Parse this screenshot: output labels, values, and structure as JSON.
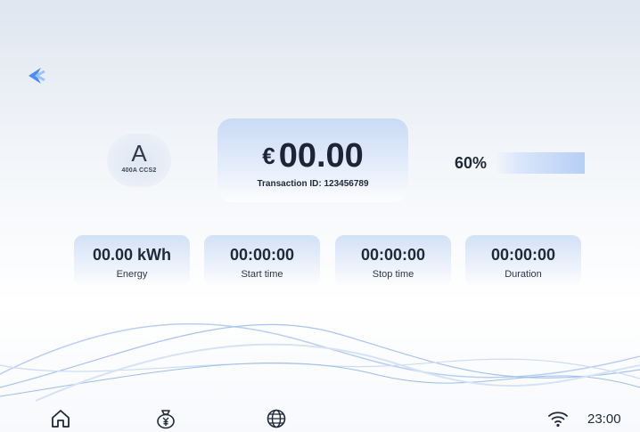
{
  "connector": {
    "letter": "A",
    "specs": "400A  CCS2"
  },
  "session": {
    "currency": "€",
    "amount": "00.00",
    "transaction_label": "Transaction ID:",
    "transaction_id": "123456789",
    "soc": "60%",
    "soc_fraction": 0.6
  },
  "stats": [
    {
      "value": "00.00 kWh",
      "label": "Energy"
    },
    {
      "value": "00:00:00",
      "label": "Start time"
    },
    {
      "value": "00:00:00",
      "label": "Stop time"
    },
    {
      "value": "00:00:00",
      "label": "Duration"
    }
  ],
  "status": {
    "time": "23:00"
  },
  "icons": {
    "back": "back-arrow-icon",
    "home": "home-icon",
    "payment": "yen-money-bag-icon",
    "language": "globe-icon",
    "wifi": "wifi-icon"
  },
  "colors": {
    "accent": "#4b8df5",
    "card": "#d2e1f7"
  }
}
